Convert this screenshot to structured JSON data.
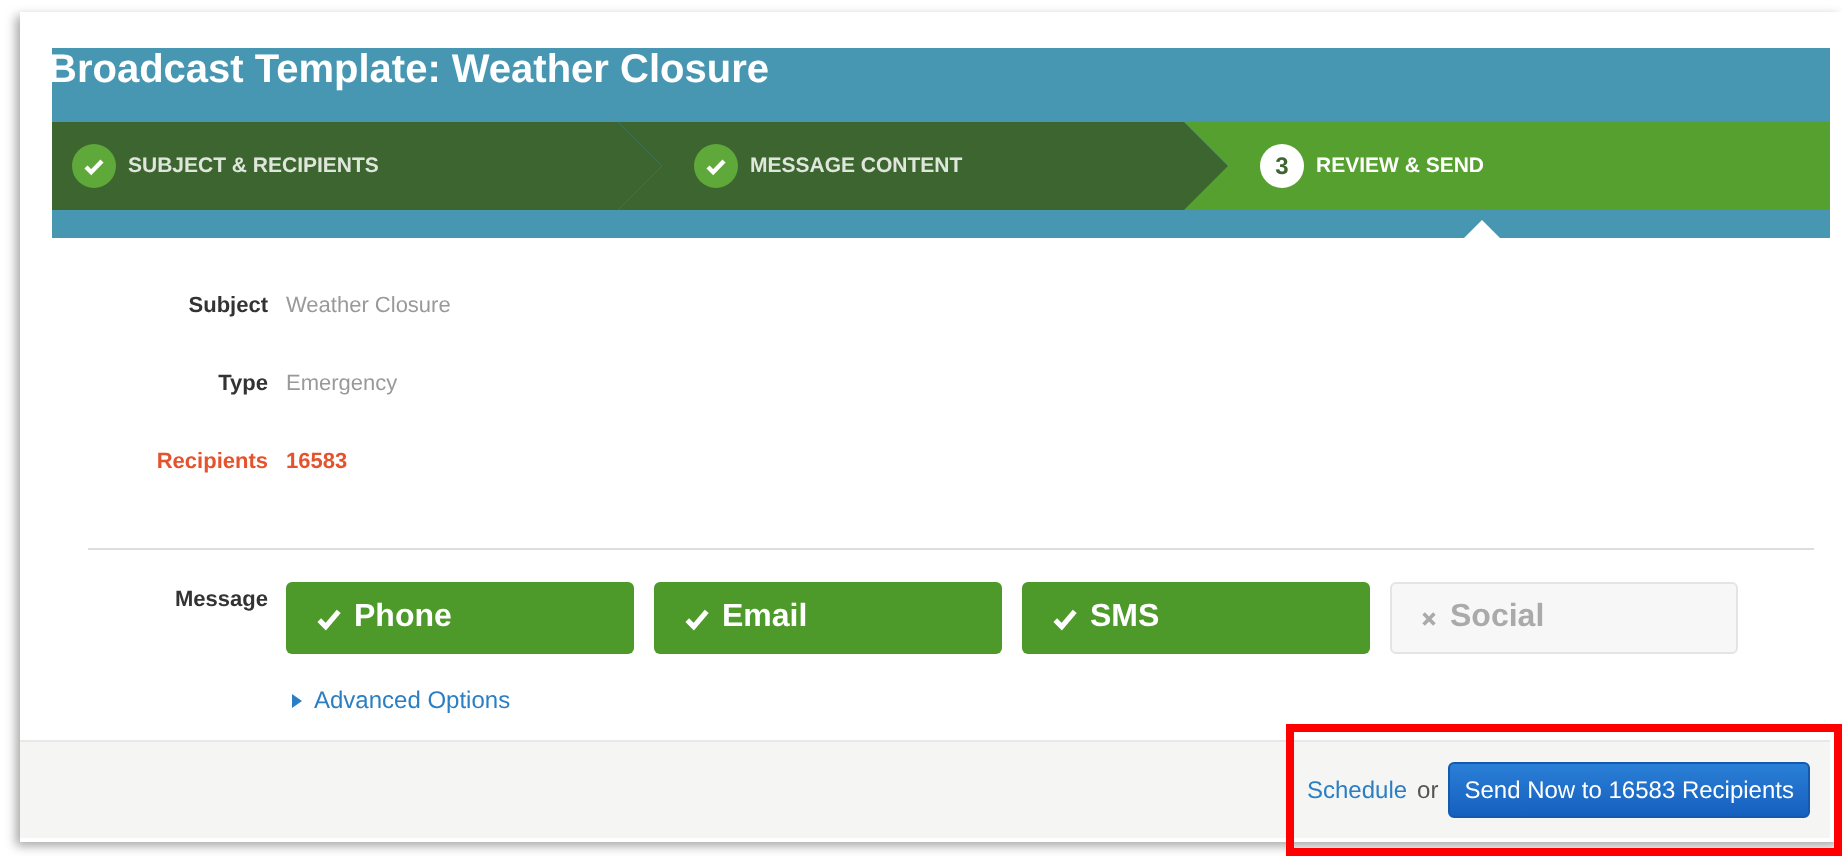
{
  "title": "Broadcast Template: Weather Closure",
  "steps": [
    {
      "label": "SUBJECT & RECIPIENTS",
      "done": true,
      "selected": false
    },
    {
      "label": "MESSAGE CONTENT",
      "done": true,
      "selected": false
    },
    {
      "label": "REVIEW & SEND",
      "number": "3",
      "done": false,
      "selected": true
    }
  ],
  "fields": [
    {
      "label": "Subject",
      "value": "Weather Closure",
      "alert": false
    },
    {
      "label": "Type",
      "value": "Emergency",
      "alert": false
    },
    {
      "label": "Recipients",
      "value": "16583",
      "alert": true
    }
  ],
  "message": {
    "label": "Message",
    "channels": [
      {
        "label": "Phone",
        "on": true
      },
      {
        "label": "Email",
        "on": true
      },
      {
        "label": "SMS",
        "on": true
      },
      {
        "label": "Social",
        "on": false
      }
    ],
    "advanced_link": "Advanced Options"
  },
  "footer": {
    "schedule_link": "Schedule",
    "or_text": "or",
    "send_button": "Send Now to 16583 Recipients"
  }
}
